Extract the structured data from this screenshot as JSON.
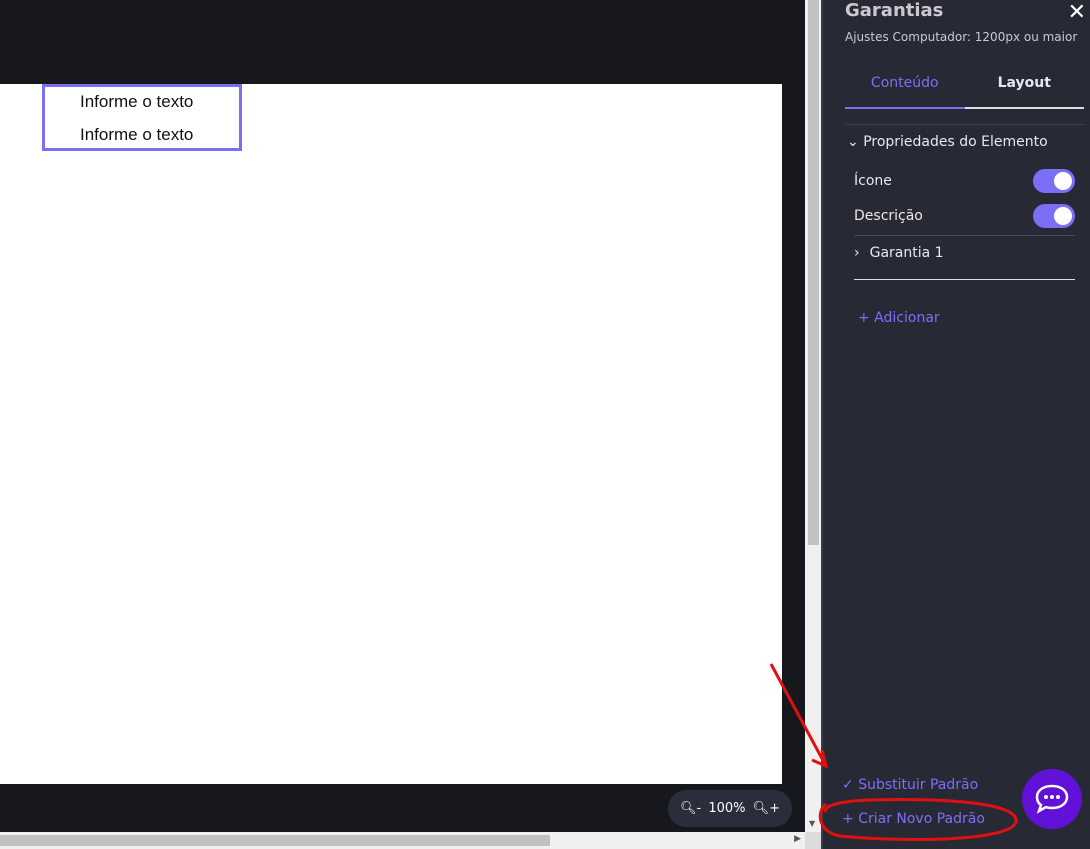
{
  "canvas": {
    "items": [
      "Informe o texto",
      "Informe o texto"
    ]
  },
  "zoom": {
    "level": "100%"
  },
  "panel": {
    "title": "Garantias",
    "subtitle": "Ajustes Computador: 1200px ou maior",
    "tabs": [
      {
        "label": "Conteúdo"
      },
      {
        "label": "Layout"
      }
    ],
    "section": "Propriedades do Elemento",
    "toggles": [
      {
        "label": "Ícone",
        "on": true
      },
      {
        "label": "Descrição",
        "on": true
      }
    ],
    "item": "Garantia 1",
    "add": "+ Adicionar",
    "replace": "Substituir Padrão",
    "create": "Criar Novo Padrão"
  },
  "colors": {
    "accent": "#7b6ff6",
    "panel": "#272a35",
    "chat": "#6212d8",
    "annotation": "#e01010"
  }
}
